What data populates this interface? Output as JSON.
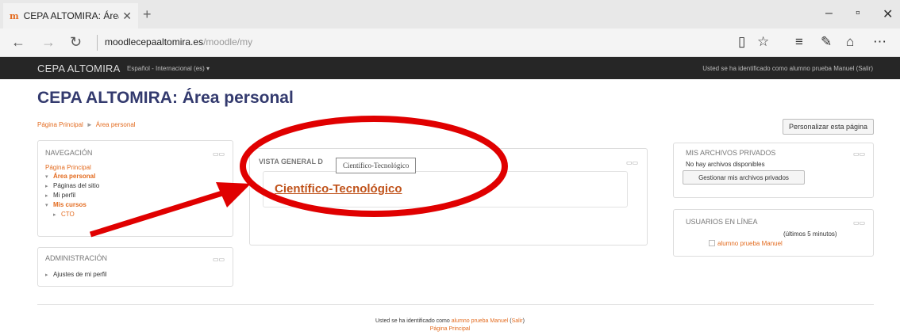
{
  "browser": {
    "tab_title": "CEPA ALTOMIRA: Área p",
    "tab_icon": "moodle-favicon-icon",
    "favicon_text": "m",
    "url_host": "moodlecepaaltomira.es",
    "url_path": "/moodle/my"
  },
  "moodle": {
    "brand": "CEPA ALTOMIRA",
    "language": "Español - Internacional (es) ▾",
    "login_info": "Usted se ha identificado como alumno prueba Manuel (Salir)",
    "page_title": "CEPA ALTOMIRA: Área personal",
    "breadcrumb": [
      "Página Principal",
      "Área personal"
    ],
    "customize_button": "Personalizar esta página"
  },
  "navigation": {
    "title": "NAVEGACIÓN",
    "home": "Página Principal",
    "items": [
      {
        "label": "Área personal",
        "style": "current",
        "bullet": "▾"
      },
      {
        "label": "Páginas del sitio",
        "style": "plain",
        "bullet": "▸"
      },
      {
        "label": "Mi perfil",
        "style": "plain",
        "bullet": "▸"
      },
      {
        "label": "Mis cursos",
        "style": "current",
        "bullet": "▾"
      },
      {
        "label": "CTO",
        "style": "link",
        "bullet": "▸"
      }
    ]
  },
  "administration": {
    "title": "ADMINISTRACIÓN",
    "items": [
      "Ajustes de mi perfil"
    ]
  },
  "overview": {
    "title": "VISTA GENERAL D",
    "course": "Científico-Tecnológico",
    "tooltip": "Científico-Tecnológico"
  },
  "private_files": {
    "title": "MIS ARCHIVOS PRIVADOS",
    "empty": "No hay archivos disponibles",
    "manage_button": "Gestionar mis archivos privados"
  },
  "online_users": {
    "title": "USUARIOS EN LÍNEA",
    "period": "(últimos 5 minutos)",
    "users": [
      "alumno prueba Manuel"
    ]
  },
  "footer": {
    "prefix": "Usted se ha identificado como",
    "user": "alumno prueba Manuel",
    "logout": "Salir",
    "home": "Página Principal"
  },
  "colors": {
    "accent": "#e36b1f",
    "annotation_red": "#e00000",
    "title_navy": "#333a6e",
    "topbar": "#262626"
  }
}
